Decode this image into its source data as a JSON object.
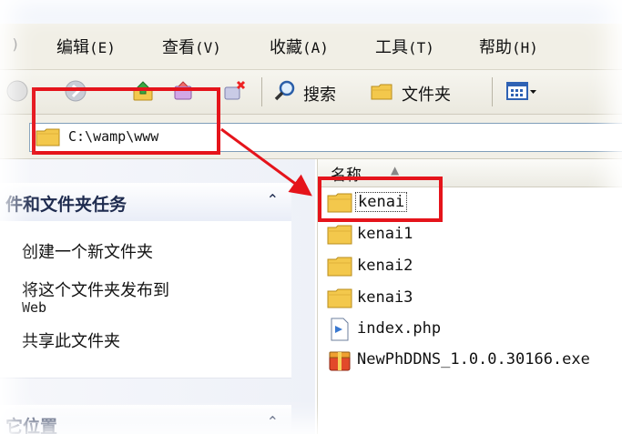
{
  "window": {
    "title": ""
  },
  "menu": {
    "items": [
      {
        "label": "编辑",
        "key": "(E)"
      },
      {
        "label": "查看",
        "key": "(V)"
      },
      {
        "label": "收藏",
        "key": "(A)"
      },
      {
        "label": "工具",
        "key": "(T)"
      },
      {
        "label": "帮助",
        "key": "(H)"
      }
    ]
  },
  "toolbar": {
    "search_label": "搜索",
    "folders_label": "文件夹"
  },
  "address": {
    "path": "C:\\wamp\\www"
  },
  "taskpane": {
    "file_tasks_title": "件和文件夹任务",
    "tasks": [
      "创建一个新文件夹",
      "将这个文件夹发布到",
      "共享此文件夹"
    ],
    "task_publish_sub": "Web",
    "other_places_title": "它位置"
  },
  "filelist": {
    "column_name": "名称",
    "files": [
      {
        "name": "kenai",
        "type": "folder",
        "selected": true
      },
      {
        "name": "kenai1",
        "type": "folder"
      },
      {
        "name": "kenai2",
        "type": "folder"
      },
      {
        "name": "kenai3",
        "type": "folder"
      },
      {
        "name": "index.php",
        "type": "php"
      },
      {
        "name": "NewPhDDNS_1.0.0.30166.exe",
        "type": "exe"
      }
    ]
  },
  "colors": {
    "annotation": "#e5141b",
    "folder": "#f3c84c"
  }
}
